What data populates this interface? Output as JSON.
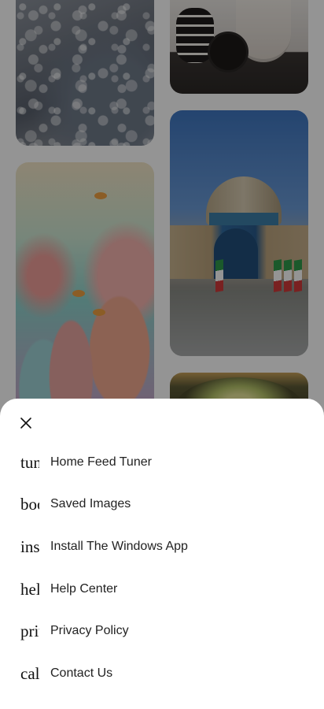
{
  "sheet": {
    "close_icon": "close-icon",
    "items": [
      {
        "icon_name": "tune-icon",
        "icon_text": "tune",
        "label": "Home Feed Tuner"
      },
      {
        "icon_name": "bookmark-icon",
        "icon_text": "bookmark",
        "label": "Saved Images"
      },
      {
        "icon_name": "install-icon",
        "icon_text": "install_desktop",
        "label": "Install The Windows App"
      },
      {
        "icon_name": "help-icon",
        "icon_text": "help",
        "label": "Help Center"
      },
      {
        "icon_name": "privacy-icon",
        "icon_text": "privacy_tip",
        "label": "Privacy Policy"
      },
      {
        "icon_name": "call-icon",
        "icon_text": "call",
        "label": "Contact Us"
      }
    ]
  },
  "colors": {
    "overlay": "rgba(0,0,0,0.42)",
    "sheet_background": "#ffffff",
    "text": "#222222"
  }
}
